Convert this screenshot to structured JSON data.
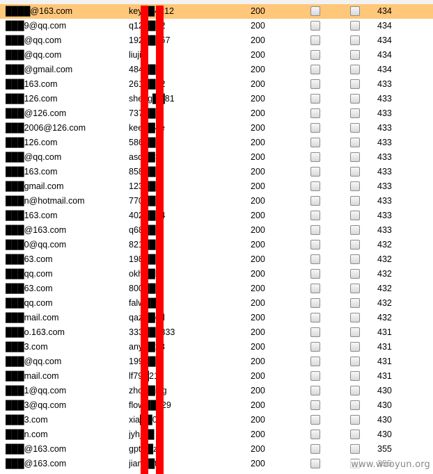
{
  "rows": [
    {
      "email": "████@163.com",
      "password": "key██4212",
      "status": "200",
      "count": "434",
      "selected": true
    },
    {
      "email": "███9@qq.com",
      "password": "q12██12",
      "status": "200",
      "count": "434"
    },
    {
      "email": "███@qq.com",
      "password": "192██857",
      "status": "200",
      "count": "434"
    },
    {
      "email": "███@qq.com",
      "password": "liuji█",
      "status": "200",
      "count": "434"
    },
    {
      "email": "███@gmail.com",
      "password": "484██1",
      "status": "200",
      "count": "434"
    },
    {
      "email": "███163.com",
      "password": "261██92",
      "status": "200",
      "count": "433"
    },
    {
      "email": "███126.com",
      "password": "sheng██81",
      "status": "200",
      "count": "433"
    },
    {
      "email": "███@126.com",
      "password": "737██d",
      "status": "200",
      "count": "433"
    },
    {
      "email": "███2006@126.com",
      "password": "kee██4e",
      "status": "200",
      "count": "433"
    },
    {
      "email": "███126.com",
      "password": "586██7",
      "status": "200",
      "count": "433"
    },
    {
      "email": "███@qq.com",
      "password": "asd██3",
      "status": "200",
      "count": "433"
    },
    {
      "email": "███163.com",
      "password": "858██3",
      "status": "200",
      "count": "433"
    },
    {
      "email": "███gmail.com",
      "password": "123██6",
      "status": "200",
      "count": "433"
    },
    {
      "email": "███n@hotmail.com",
      "password": "770██7",
      "status": "200",
      "count": "433"
    },
    {
      "email": "███163.com",
      "password": "402██04",
      "status": "200",
      "count": "433"
    },
    {
      "email": "███@163.com",
      "password": "q68██a",
      "status": "200",
      "count": "433"
    },
    {
      "email": "███0@qq.com",
      "password": "821██li",
      "status": "200",
      "count": "432"
    },
    {
      "email": "███63.com",
      "password": "198██1",
      "status": "200",
      "count": "432"
    },
    {
      "email": "███qq.com",
      "password": "okh██k",
      "status": "200",
      "count": "432"
    },
    {
      "email": "███63.com",
      "password": "800██4",
      "status": "200",
      "count": "432"
    },
    {
      "email": "███qq.com",
      "password": "falw██e",
      "status": "200",
      "count": "432"
    },
    {
      "email": "███mail.com",
      "password": "qaz██ed",
      "status": "200",
      "count": "432"
    },
    {
      "email": "███o.163.com",
      "password": "333██8333",
      "status": "200",
      "count": "431"
    },
    {
      "email": "███3.com",
      "password": "any██23",
      "status": "200",
      "count": "431"
    },
    {
      "email": "███@qq.com",
      "password": "199██8",
      "status": "200",
      "count": "431"
    },
    {
      "email": "███mail.com",
      "password": "lf79█21",
      "status": "200",
      "count": "431"
    },
    {
      "email": "███1@qq.com",
      "password": "zho██ing",
      "status": "200",
      "count": "430"
    },
    {
      "email": "███3@qq.com",
      "password": "flow██729",
      "status": "200",
      "count": "430"
    },
    {
      "email": "███3.com",
      "password": "xia██00",
      "status": "200",
      "count": "430"
    },
    {
      "email": "███n.com",
      "password": "jyhj██",
      "status": "200",
      "count": "430"
    },
    {
      "email": "███@163.com",
      "password": "gpt██zx",
      "status": "200",
      "count": "355"
    },
    {
      "email": "███@163.com",
      "password": "jian██t",
      "status": "200",
      "count": "355"
    }
  ],
  "watermark": "www.wooyun.org"
}
